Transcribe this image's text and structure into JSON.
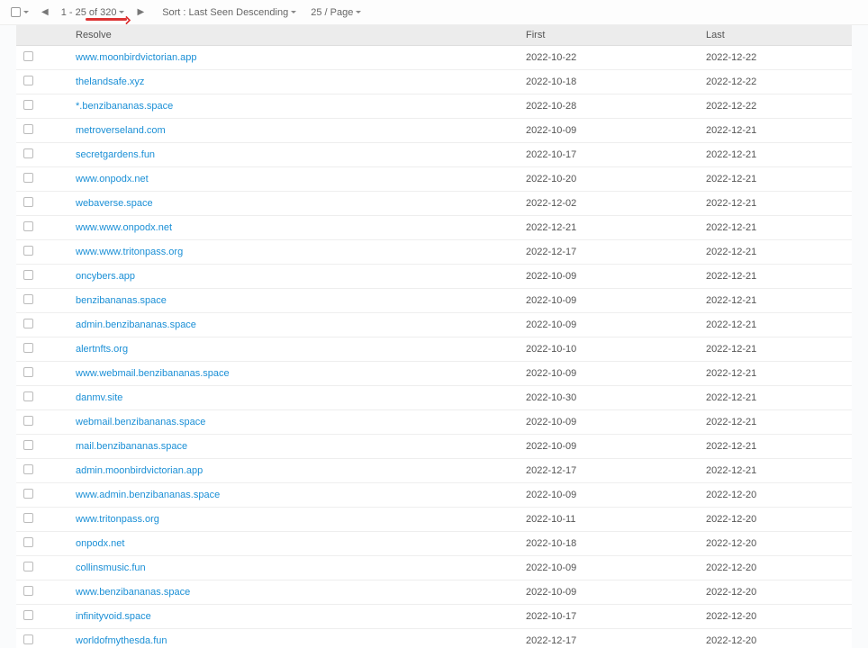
{
  "toolbar": {
    "pager_text": "1 - 25 of 320",
    "sort_text": "Sort : Last Seen Descending",
    "per_page_text": "25 / Page"
  },
  "headers": {
    "resolve": "Resolve",
    "first": "First",
    "last": "Last"
  },
  "rows": [
    {
      "resolve": "www.moonbirdvictorian.app",
      "first": "2022-10-22",
      "last": "2022-12-22"
    },
    {
      "resolve": "thelandsafe.xyz",
      "first": "2022-10-18",
      "last": "2022-12-22"
    },
    {
      "resolve": "*.benzibananas.space",
      "first": "2022-10-28",
      "last": "2022-12-22"
    },
    {
      "resolve": "metroverseland.com",
      "first": "2022-10-09",
      "last": "2022-12-21"
    },
    {
      "resolve": "secretgardens.fun",
      "first": "2022-10-17",
      "last": "2022-12-21"
    },
    {
      "resolve": "www.onpodx.net",
      "first": "2022-10-20",
      "last": "2022-12-21"
    },
    {
      "resolve": "webaverse.space",
      "first": "2022-12-02",
      "last": "2022-12-21"
    },
    {
      "resolve": "www.www.onpodx.net",
      "first": "2022-12-21",
      "last": "2022-12-21"
    },
    {
      "resolve": "www.www.tritonpass.org",
      "first": "2022-12-17",
      "last": "2022-12-21"
    },
    {
      "resolve": "oncybers.app",
      "first": "2022-10-09",
      "last": "2022-12-21"
    },
    {
      "resolve": "benzibananas.space",
      "first": "2022-10-09",
      "last": "2022-12-21"
    },
    {
      "resolve": "admin.benzibananas.space",
      "first": "2022-10-09",
      "last": "2022-12-21"
    },
    {
      "resolve": "alertnfts.org",
      "first": "2022-10-10",
      "last": "2022-12-21"
    },
    {
      "resolve": "www.webmail.benzibananas.space",
      "first": "2022-10-09",
      "last": "2022-12-21"
    },
    {
      "resolve": "danmv.site",
      "first": "2022-10-30",
      "last": "2022-12-21"
    },
    {
      "resolve": "webmail.benzibananas.space",
      "first": "2022-10-09",
      "last": "2022-12-21"
    },
    {
      "resolve": "mail.benzibananas.space",
      "first": "2022-10-09",
      "last": "2022-12-21"
    },
    {
      "resolve": "admin.moonbirdvictorian.app",
      "first": "2022-12-17",
      "last": "2022-12-21"
    },
    {
      "resolve": "www.admin.benzibananas.space",
      "first": "2022-10-09",
      "last": "2022-12-20"
    },
    {
      "resolve": "www.tritonpass.org",
      "first": "2022-10-11",
      "last": "2022-12-20"
    },
    {
      "resolve": "onpodx.net",
      "first": "2022-10-18",
      "last": "2022-12-20"
    },
    {
      "resolve": "collinsmusic.fun",
      "first": "2022-10-09",
      "last": "2022-12-20"
    },
    {
      "resolve": "www.benzibananas.space",
      "first": "2022-10-09",
      "last": "2022-12-20"
    },
    {
      "resolve": "infinityvoid.space",
      "first": "2022-10-17",
      "last": "2022-12-20"
    },
    {
      "resolve": "worldofmythesda.fun",
      "first": "2022-12-17",
      "last": "2022-12-20"
    }
  ]
}
